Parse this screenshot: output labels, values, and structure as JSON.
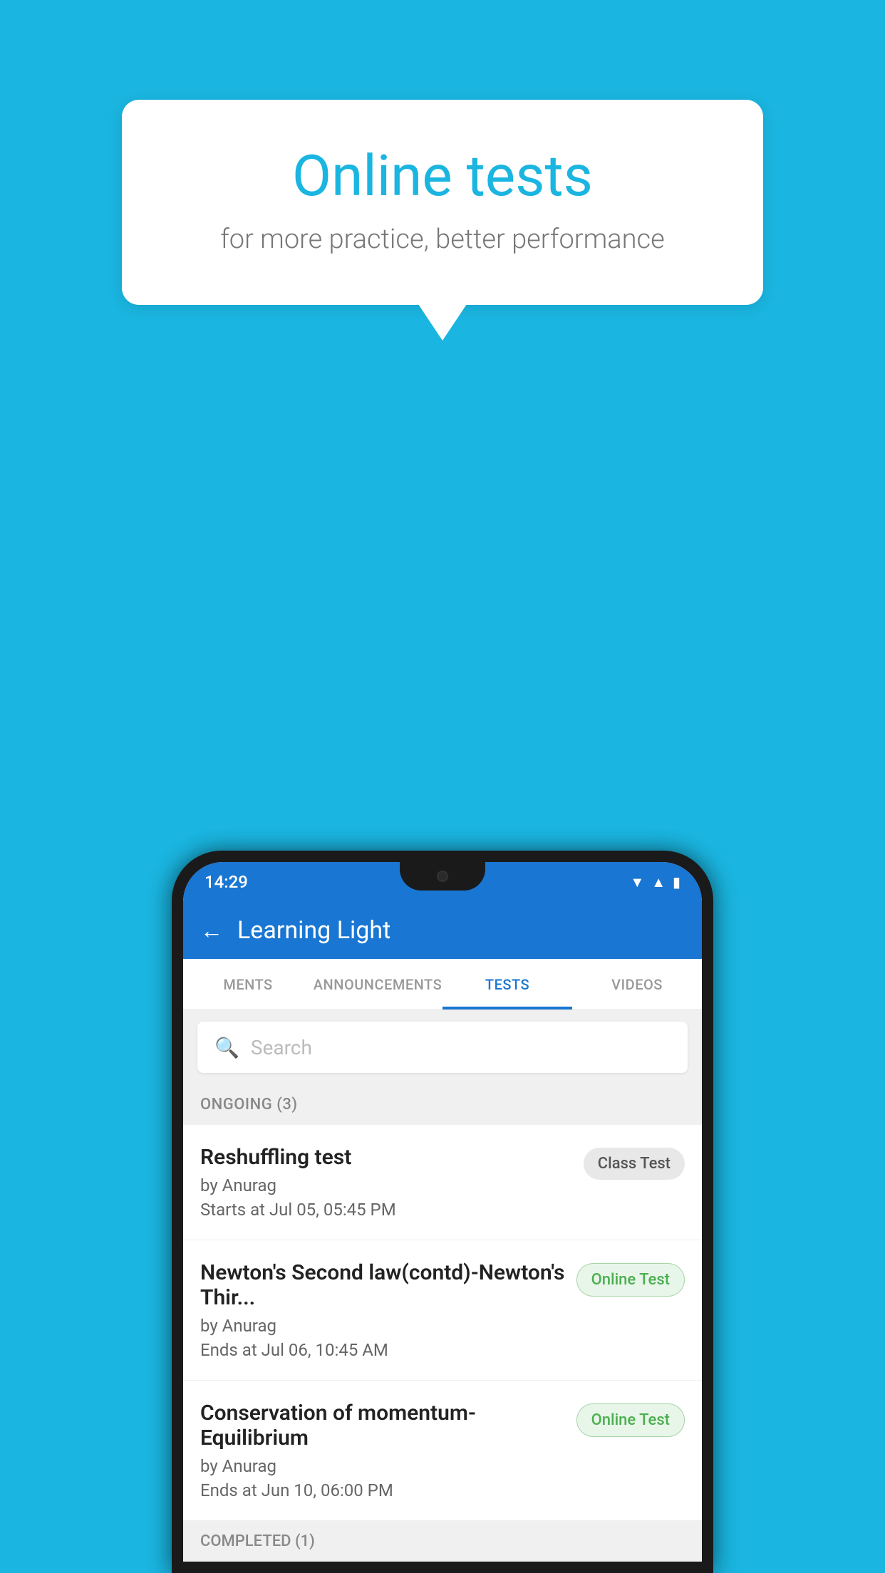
{
  "background_color": "#1ab5e0",
  "bubble": {
    "title": "Online tests",
    "subtitle": "for more practice, better performance"
  },
  "phone": {
    "status_bar": {
      "time": "14:29",
      "icons": [
        "wifi",
        "signal",
        "battery"
      ]
    },
    "app_header": {
      "back_label": "←",
      "title": "Learning Light"
    },
    "tabs": [
      {
        "label": "MENTS",
        "active": false
      },
      {
        "label": "ANNOUNCEMENTS",
        "active": false
      },
      {
        "label": "TESTS",
        "active": true
      },
      {
        "label": "VIDEOS",
        "active": false
      }
    ],
    "search": {
      "placeholder": "Search"
    },
    "sections": [
      {
        "header": "ONGOING (3)",
        "items": [
          {
            "name": "Reshuffling test",
            "author": "by Anurag",
            "time_label": "Starts at  Jul 05, 05:45 PM",
            "badge": "Class Test",
            "badge_type": "class"
          },
          {
            "name": "Newton's Second law(contd)-Newton's Thir...",
            "author": "by Anurag",
            "time_label": "Ends at  Jul 06, 10:45 AM",
            "badge": "Online Test",
            "badge_type": "online"
          },
          {
            "name": "Conservation of momentum-Equilibrium",
            "author": "by Anurag",
            "time_label": "Ends at  Jun 10, 06:00 PM",
            "badge": "Online Test",
            "badge_type": "online"
          }
        ]
      }
    ],
    "completed_header": "COMPLETED (1)"
  }
}
